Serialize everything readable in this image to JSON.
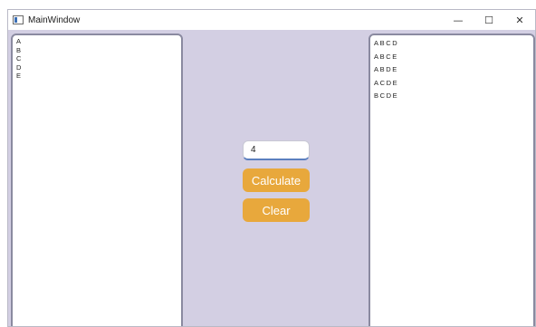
{
  "window": {
    "title": "MainWindow",
    "controls": {
      "minimize": "—",
      "maximize": "☐",
      "close": "✕"
    }
  },
  "left_list": {
    "items": [
      "A",
      "B",
      "C",
      "D",
      "E"
    ]
  },
  "right_list": {
    "items": [
      "ABCD",
      "ABCE",
      "ABDE",
      "ACDE",
      "BCDE"
    ]
  },
  "input": {
    "value": "4"
  },
  "buttons": {
    "calculate": "Calculate",
    "clear": "Clear"
  },
  "colors": {
    "background": "#d3cfe3",
    "button": "#e8a83c"
  },
  "icons": {
    "app": "window-app-icon"
  }
}
